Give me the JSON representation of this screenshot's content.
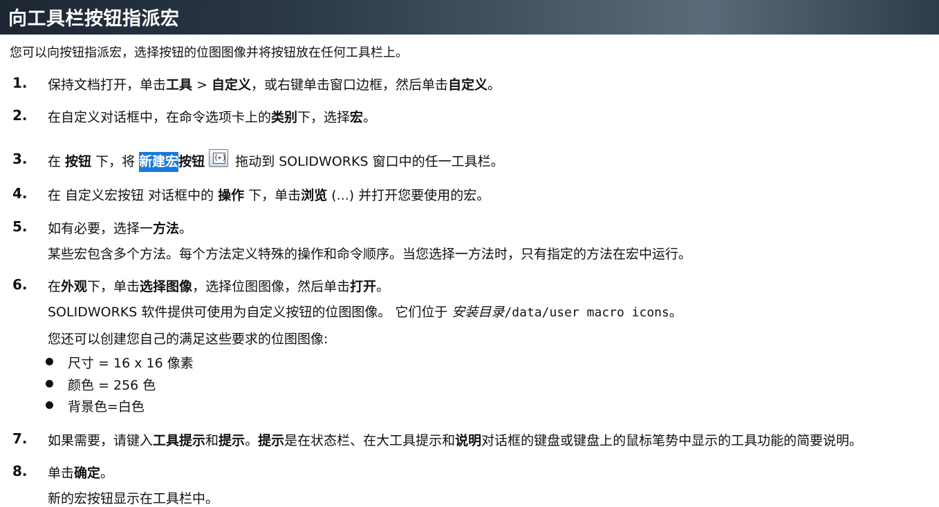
{
  "header": {
    "title": "向工具栏按钮指派宏"
  },
  "intro": "您可以向按钮指派宏，选择按钮的位图图像并将按钮放在任何工具栏上。",
  "steps": [
    {
      "number": "1.",
      "p1": "保持文档打开，单击",
      "tools": "工具",
      "sep": " > ",
      "customize": "自定义",
      "p2": "，或右键单击窗口边框，然后单击",
      "customize2": "自定义",
      "p3": "。"
    },
    {
      "number": "2.",
      "p1": "在自定义对话框中，在命令选项卡上的",
      "category": "类别",
      "p2": "下，选择",
      "macro": "宏",
      "p3": "。"
    },
    {
      "number": "3.",
      "p1": "在 ",
      "buttons": "按钮",
      "p2": " 下，将 ",
      "new_macro": "新建宏",
      "button_word": "按钮",
      "icon_glyph": "{▸}",
      "p3": "拖动到 SOLIDWORKS 窗口中的任一工具栏。"
    },
    {
      "number": "4.",
      "p1": "在 自定义宏按钮 对话框中的 ",
      "action": "操作",
      "p2": " 下，单击",
      "browse": "浏览",
      "p3": " (...) 并打开您要使用的宏。"
    },
    {
      "number": "5.",
      "p1": "如有必要，选择一",
      "method": "方法",
      "p2": "。",
      "note": "某些宏包含多个方法。每个方法定义特殊的操作和命令顺序。当您选择一方法时，只有指定的方法在宏中运行。"
    },
    {
      "number": "6.",
      "p1": "在",
      "appearance": "外观",
      "p2": "下，单击",
      "choose_image": "选择图像",
      "p3": "，选择位图图像，然后单击",
      "open": "打开",
      "p4": "。",
      "note1": "SOLIDWORKS 软件提供可使用为自定义按钮的位图图像。 它们位于 ",
      "install_dir": "安装目录",
      "path": "/data/user macro icons",
      "note1_end": "。",
      "note2": "您还可以创建您自己的满足这些要求的位图图像:",
      "bullets": [
        "尺寸 = 16 x 16 像素",
        "颜色 = 256 色",
        "背景色=白色"
      ]
    },
    {
      "number": "7.",
      "p1": "如果需要，请键入",
      "tooltip": "工具提示",
      "p2": "和",
      "hint": "提示",
      "p3": "。",
      "hint2": "提示",
      "p4": "是在状态栏、在大工具提示和",
      "description": "说明",
      "p5": "对话框的键盘或键盘上的鼠标笔势中显示的工具功能的简要说明。"
    },
    {
      "number": "8.",
      "p1": "单击",
      "ok": "确定",
      "p2": "。",
      "note": "新的宏按钮显示在工具栏中。"
    }
  ]
}
